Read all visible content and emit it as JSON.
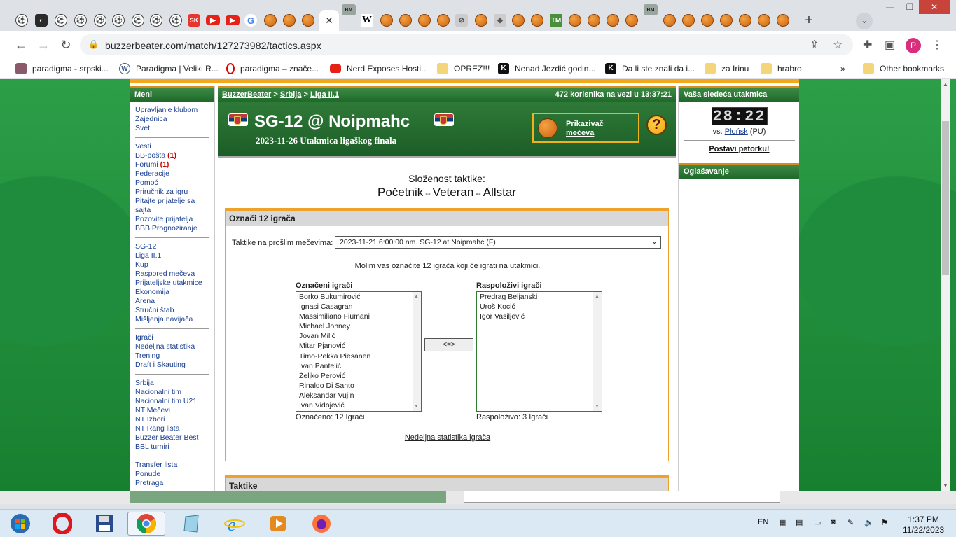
{
  "browser": {
    "url": "buzzerbeater.com/match/127273982/tactics.aspx",
    "bookmarks": [
      {
        "label": "paradigma - srpski...",
        "icon": "image-icon"
      },
      {
        "label": "Paradigma | Veliki R...",
        "icon": "wordpress-icon"
      },
      {
        "label": "paradigma – znače...",
        "icon": "opera-icon"
      },
      {
        "label": "Nerd Exposes Hosti...",
        "icon": "youtube-icon"
      },
      {
        "label": "OPREZ!!!",
        "icon": "folder-icon"
      },
      {
        "label": "Nenad Jezdić godin...",
        "icon": "k-icon"
      },
      {
        "label": "Da li ste znali da i...",
        "icon": "k-icon"
      },
      {
        "label": "za Irinu",
        "icon": "folder-icon"
      },
      {
        "label": "hrabro",
        "icon": "folder-icon"
      }
    ],
    "more_bookmarks": "»",
    "other_bookmarks": "Other bookmarks",
    "profile_initial": "P"
  },
  "menu": {
    "title": "Meni",
    "groups": [
      [
        "Upravljanje klubom",
        "Zajednica",
        "Svet"
      ],
      [
        "Vesti",
        "BB-pošta",
        "Forumi",
        "Federacije",
        "Pomoć",
        "Priručnik za igru",
        "Pitajte prijatelje sa sajta",
        "Pozovite prijatelja",
        "BBB Prognoziranje"
      ],
      [
        "SG-12",
        "Liga II.1",
        "Kup",
        "Raspored mečeva",
        "Prijateljske utakmice",
        "Ekonomija",
        "Arena",
        "Stručni štab",
        "Mišljenja navijača"
      ],
      [
        "Igrači",
        "Nedeljna statistika",
        "Trening",
        "Draft i Skauting"
      ],
      [
        "Srbija",
        "Nacionalni tim",
        "Nacionalni tim U21",
        "NT Mečevi",
        "NT Izbori",
        "NT Rang lista",
        "Buzzer Beater Best",
        "BBL turniri"
      ],
      [
        "Transfer lista",
        "Ponude",
        "Pretraga"
      ]
    ],
    "mail_badge": "(1)",
    "forum_badge": "(1)"
  },
  "breadcrumb": {
    "site": "BuzzerBeater",
    "country": "Srbija",
    "league": "Liga II.1",
    "sep": " > ",
    "online": "472 korisnika na vezi u 13:37:21"
  },
  "match": {
    "title": "SG-12 @ Noipmahc",
    "subtitle": "2023-11-26 Utakmica ligaškog finala",
    "viewer_label_1": "Prikazivač",
    "viewer_label_2": "mečeva",
    "help": "?"
  },
  "complexity": {
    "label": "Složenost taktike:",
    "levels": [
      "Početnik",
      "Veteran",
      "Allstar"
    ],
    "sep": " -- "
  },
  "select_players": {
    "title": "Označi 12 igrača",
    "past_label": "Taktike na prošlim mečevima:",
    "past_value": "2023-11-21 6:00:00 nm. SG-12 at Noipmahc (F)",
    "instruction": "Molim vas označite 12 igrača koji će igrati na utakmici.",
    "selected_label": "Označeni igrači",
    "available_label": "Raspoloživi igrači",
    "selected": [
      "Borko Bukumirović",
      "Ignasi Casagran",
      "Massimiliano Fiumani",
      "Michael Johney",
      "Jovan Milić",
      "Mitar Pjanović",
      "Timo-Pekka Piesanen",
      "Ivan Pantelić",
      "Željko Perović",
      "Rinaldo Di Santo",
      "Aleksandar Vujin",
      "Ivan Vidojević"
    ],
    "available": [
      "Predrag Beljanski",
      "Uroš Kocić",
      "Igor Vasiljević"
    ],
    "swap": "<=>",
    "selected_count": "Označeno: 12 Igrači",
    "available_count": "Raspoloživo: 3 Igrači",
    "weekly_link": "Nedeljna statistika igrača"
  },
  "tactics": {
    "title": "Taktike"
  },
  "next_match": {
    "title": "Vaša sledeća utakmica",
    "countdown": "28:22",
    "vs_prefix": "vs.",
    "opponent": "Płońsk",
    "opponent_suffix": "(PU)",
    "set_five": "Postavi petorku!"
  },
  "ads": {
    "title": "Oglašavanje"
  },
  "taskbar": {
    "lang": "EN",
    "time": "1:37 PM",
    "date": "11/22/2023"
  }
}
